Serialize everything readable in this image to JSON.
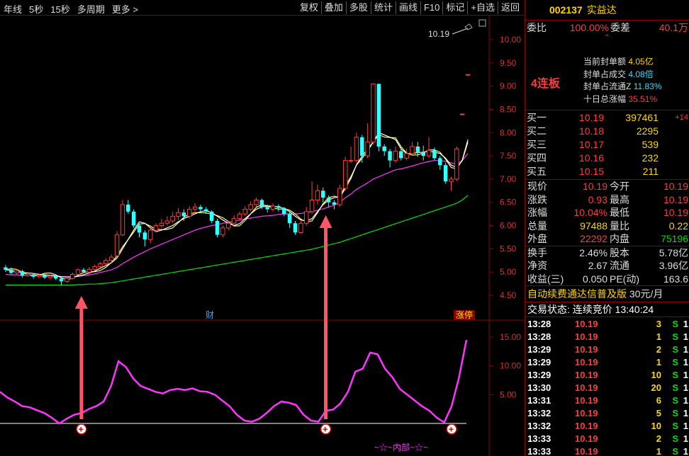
{
  "toolbar": {
    "left": [
      "年线",
      "5秒",
      "15秒",
      "多周期",
      "更多 >"
    ],
    "right": [
      "复权",
      "叠加",
      "多股",
      "统计",
      "画线",
      "F10",
      "标记",
      "+自选",
      "返回"
    ]
  },
  "chart": {
    "price_ticks": [
      "10.00",
      "9.50",
      "9.00",
      "8.50",
      "8.00",
      "7.50",
      "7.00",
      "6.50",
      "6.00",
      "5.50",
      "5.00",
      "4.50"
    ],
    "osc_ticks": [
      "15.00",
      "10.00",
      "5.00"
    ],
    "max_label": "10.19",
    "marker_cai": "财",
    "marker_zhangting": "涨停",
    "bottom_label": "~☆~内部~☆~",
    "colors": {
      "up": "#ff3b3b",
      "down": "#33ffff",
      "ma5": "#ffffff",
      "ma10": "#ffff66",
      "ma20": "#ff33ff",
      "ma60": "#00e000",
      "osc": "#ff33ff",
      "arrow": "#ff5566"
    }
  },
  "stock": {
    "code": "002137",
    "name": "实益达"
  },
  "summary": {
    "weibi_label": "委比",
    "weibi_value": "100.00%",
    "weicha_label": "委差",
    "weicha_value": "40.1万"
  },
  "seal": {
    "tag": "4连板",
    "lines": [
      {
        "label": "当前封单额",
        "value": "4.05亿"
      },
      {
        "label": "封单占成交",
        "value": "4.08倍"
      },
      {
        "label": "封单占流通Z",
        "value": "11.83%"
      },
      {
        "label": "十日总涨幅",
        "value": "35.51%"
      }
    ]
  },
  "bids": [
    {
      "label": "买一",
      "price": "10.19",
      "vol": "397461",
      "chg": "+14"
    },
    {
      "label": "买二",
      "price": "10.18",
      "vol": "2295",
      "chg": ""
    },
    {
      "label": "买三",
      "price": "10.17",
      "vol": "539",
      "chg": ""
    },
    {
      "label": "买四",
      "price": "10.16",
      "vol": "232",
      "chg": ""
    },
    {
      "label": "买五",
      "price": "10.15",
      "vol": "211",
      "chg": ""
    }
  ],
  "quote": [
    {
      "l1": "现价",
      "v1": "10.19",
      "c1": "red",
      "l2": "今开",
      "v2": "10.19",
      "c2": "red"
    },
    {
      "l1": "涨跌",
      "v1": "0.93",
      "c1": "red",
      "l2": "最高",
      "v2": "10.19",
      "c2": "red"
    },
    {
      "l1": "涨幅",
      "v1": "10.04%",
      "c1": "red",
      "l2": "最低",
      "v2": "10.19",
      "c2": "red"
    },
    {
      "l1": "总量",
      "v1": "97488",
      "c1": "ylw",
      "l2": "量比",
      "v2": "0.22",
      "c2": "ylw"
    },
    {
      "l1": "外盘",
      "v1": "22292",
      "c1": "red",
      "l2": "内盘",
      "v2": "75196",
      "c2": "grn"
    }
  ],
  "fin": [
    {
      "l1": "换手",
      "v1": "2.46%",
      "l2": "股本",
      "v2": "5.78亿"
    },
    {
      "l1": "净资",
      "v1": "2.67",
      "l2": "流通",
      "v2": "3.96亿"
    },
    {
      "l1": "收益(三)",
      "v1": "0.050",
      "l2": "PE(动)",
      "v2": "163.6"
    }
  ],
  "ad": {
    "text": "自动续费通达信普及版",
    "price": "30元/月"
  },
  "trade_status": {
    "label": "交易状态:",
    "value": "连续竞价",
    "time": "13:40:24"
  },
  "ticks": [
    {
      "t": "13:28",
      "p": "10.19",
      "v": "3",
      "s": "S",
      "n": "1"
    },
    {
      "t": "13:28",
      "p": "10.19",
      "v": "1",
      "s": "S",
      "n": "1"
    },
    {
      "t": "13:29",
      "p": "10.19",
      "v": "2",
      "s": "S",
      "n": "1"
    },
    {
      "t": "13:29",
      "p": "10.19",
      "v": "1",
      "s": "S",
      "n": "1"
    },
    {
      "t": "13:29",
      "p": "10.19",
      "v": "10",
      "s": "S",
      "n": "1"
    },
    {
      "t": "13:30",
      "p": "10.19",
      "v": "20",
      "s": "S",
      "n": "1"
    },
    {
      "t": "13:31",
      "p": "10.19",
      "v": "6",
      "s": "S",
      "n": "1"
    },
    {
      "t": "13:32",
      "p": "10.19",
      "v": "5",
      "s": "S",
      "n": "1"
    },
    {
      "t": "13:32",
      "p": "10.19",
      "v": "10",
      "s": "S",
      "n": "1"
    },
    {
      "t": "13:33",
      "p": "10.19",
      "v": "2",
      "s": "S",
      "n": "1"
    },
    {
      "t": "13:33",
      "p": "10.19",
      "v": "1",
      "s": "S",
      "n": "1"
    }
  ],
  "chart_data": {
    "type": "candlestick",
    "price_axis": {
      "min": 4.3,
      "max": 10.2
    },
    "candles": [
      [
        5.1,
        5.05,
        5.15,
        5.0
      ],
      [
        5.05,
        4.98,
        5.1,
        4.95
      ],
      [
        4.98,
        5.02,
        5.06,
        4.94
      ],
      [
        5.02,
        4.92,
        5.05,
        4.88
      ],
      [
        4.92,
        4.95,
        5.0,
        4.9
      ],
      [
        4.95,
        4.9,
        4.98,
        4.86
      ],
      [
        4.9,
        4.93,
        4.97,
        4.87
      ],
      [
        4.93,
        4.88,
        4.96,
        4.85
      ],
      [
        4.88,
        4.91,
        4.95,
        4.84
      ],
      [
        4.91,
        4.86,
        4.94,
        4.83
      ],
      [
        4.86,
        4.8,
        4.89,
        4.72
      ],
      [
        4.8,
        4.86,
        4.9,
        4.77
      ],
      [
        4.86,
        4.95,
        4.99,
        4.84
      ],
      [
        4.95,
        5.05,
        5.08,
        4.93
      ],
      [
        5.05,
        5.0,
        5.09,
        4.97
      ],
      [
        5.0,
        5.06,
        5.11,
        4.98
      ],
      [
        5.06,
        5.12,
        5.16,
        5.03
      ],
      [
        5.12,
        5.18,
        5.22,
        5.09
      ],
      [
        5.18,
        5.25,
        5.3,
        5.15
      ],
      [
        5.25,
        5.32,
        5.38,
        5.2
      ],
      [
        5.35,
        5.8,
        5.88,
        5.3
      ],
      [
        5.8,
        6.45,
        6.55,
        5.78
      ],
      [
        6.45,
        6.3,
        6.55,
        6.25
      ],
      [
        6.3,
        6.0,
        6.35,
        5.95
      ],
      [
        6.0,
        5.85,
        6.05,
        5.75
      ],
      [
        5.85,
        5.7,
        5.9,
        5.55
      ],
      [
        5.7,
        5.9,
        5.95,
        5.62
      ],
      [
        5.9,
        6.0,
        6.05,
        5.85
      ],
      [
        6.0,
        6.05,
        6.15,
        5.95
      ],
      [
        6.05,
        6.1,
        6.2,
        6.0
      ],
      [
        6.1,
        6.2,
        6.3,
        6.05
      ],
      [
        6.2,
        6.28,
        6.38,
        6.12
      ],
      [
        6.28,
        6.2,
        6.35,
        6.1
      ],
      [
        6.2,
        6.35,
        6.42,
        6.15
      ],
      [
        6.35,
        6.4,
        6.48,
        6.25
      ],
      [
        6.4,
        6.35,
        6.45,
        6.28
      ],
      [
        6.35,
        6.3,
        6.4,
        6.25
      ],
      [
        6.3,
        6.1,
        6.33,
        6.05
      ],
      [
        6.1,
        5.8,
        6.15,
        5.75
      ],
      [
        5.8,
        5.95,
        6.0,
        5.75
      ],
      [
        5.95,
        6.05,
        6.1,
        5.9
      ],
      [
        6.05,
        6.15,
        6.22,
        6.0
      ],
      [
        6.15,
        6.25,
        6.3,
        6.1
      ],
      [
        6.25,
        6.35,
        6.42,
        6.2
      ],
      [
        6.35,
        6.45,
        6.52,
        6.3
      ],
      [
        6.45,
        6.55,
        6.6,
        6.4
      ],
      [
        6.55,
        6.4,
        6.58,
        6.35
      ],
      [
        6.4,
        6.35,
        6.45,
        6.28
      ],
      [
        6.35,
        6.42,
        6.48,
        6.3
      ],
      [
        6.42,
        6.38,
        6.46,
        6.3
      ],
      [
        6.38,
        6.25,
        6.4,
        6.2
      ],
      [
        6.25,
        6.05,
        6.3,
        5.95
      ],
      [
        6.05,
        5.85,
        6.1,
        5.8
      ],
      [
        5.85,
        6.05,
        6.12,
        5.82
      ],
      [
        6.05,
        6.3,
        6.4,
        6.0
      ],
      [
        6.3,
        6.55,
        6.95,
        6.25
      ],
      [
        6.55,
        6.75,
        6.88,
        6.45
      ],
      [
        6.75,
        6.6,
        6.82,
        6.5
      ],
      [
        6.6,
        6.5,
        6.65,
        6.4
      ],
      [
        6.5,
        6.45,
        6.55,
        6.35
      ],
      [
        6.45,
        6.8,
        6.88,
        6.4
      ],
      [
        6.8,
        7.4,
        7.48,
        6.75
      ],
      [
        7.4,
        7.4,
        7.7,
        7.35
      ],
      [
        7.4,
        7.9,
        8.0,
        7.35
      ],
      [
        7.9,
        7.5,
        7.95,
        7.35
      ],
      [
        7.5,
        7.8,
        8.2,
        7.45
      ],
      [
        7.8,
        9.05,
        9.05,
        7.75
      ],
      [
        9.05,
        7.7,
        9.05,
        7.6
      ],
      [
        7.7,
        7.6,
        7.75,
        7.5
      ],
      [
        7.6,
        7.4,
        7.65,
        7.25
      ],
      [
        7.4,
        7.6,
        7.7,
        7.35
      ],
      [
        7.6,
        7.45,
        7.7,
        7.4
      ],
      [
        7.45,
        7.55,
        7.65,
        7.4
      ],
      [
        7.55,
        7.7,
        7.8,
        7.5
      ],
      [
        7.7,
        7.58,
        7.8,
        7.48
      ],
      [
        7.58,
        7.5,
        7.72,
        7.4
      ],
      [
        7.5,
        7.62,
        7.9,
        7.45
      ],
      [
        7.62,
        7.45,
        7.68,
        7.4
      ],
      [
        7.45,
        7.3,
        7.5,
        7.2
      ],
      [
        7.3,
        6.95,
        7.35,
        6.9
      ],
      [
        6.95,
        7.0,
        7.05,
        6.75
      ],
      [
        7.0,
        7.65,
        7.7,
        6.95
      ],
      [
        8.4,
        8.4,
        8.4,
        8.4
      ],
      [
        9.25,
        9.25,
        9.25,
        9.25
      ]
    ],
    "ma5": [
      5.05,
      5.03,
      5.01,
      4.99,
      4.98,
      4.97,
      4.95,
      4.94,
      4.93,
      4.92,
      4.9,
      4.89,
      4.89,
      4.91,
      4.94,
      4.98,
      5.02,
      5.08,
      5.14,
      5.2,
      5.3,
      5.5,
      5.7,
      5.9,
      6.08,
      6.05,
      5.95,
      5.87,
      5.9,
      5.95,
      6.0,
      6.08,
      6.15,
      6.2,
      6.25,
      6.3,
      6.32,
      6.28,
      6.2,
      6.12,
      6.05,
      6.0,
      6.04,
      6.15,
      6.25,
      6.35,
      6.4,
      6.42,
      6.42,
      6.4,
      6.37,
      6.3,
      6.2,
      6.12,
      6.1,
      6.15,
      6.3,
      6.45,
      6.55,
      6.6,
      6.62,
      6.85,
      7.05,
      7.3,
      7.45,
      7.6,
      7.8,
      8.0,
      7.95,
      7.9,
      7.85,
      7.65,
      7.55,
      7.55,
      7.57,
      7.58,
      7.6,
      7.58,
      7.55,
      7.45,
      7.3,
      7.25,
      7.4,
      7.8
    ],
    "ma20": [
      4.95,
      4.94,
      4.94,
      4.93,
      4.93,
      4.92,
      4.92,
      4.91,
      4.91,
      4.91,
      4.9,
      4.9,
      4.9,
      4.91,
      4.92,
      4.94,
      4.96,
      4.99,
      5.02,
      5.05,
      5.1,
      5.18,
      5.25,
      5.32,
      5.38,
      5.44,
      5.5,
      5.55,
      5.6,
      5.65,
      5.7,
      5.75,
      5.8,
      5.85,
      5.9,
      5.94,
      5.97,
      6.0,
      6.02,
      6.05,
      6.07,
      6.09,
      6.12,
      6.14,
      6.16,
      6.18,
      6.2,
      6.21,
      6.22,
      6.24,
      6.25,
      6.25,
      6.25,
      6.26,
      6.28,
      6.3,
      6.33,
      6.36,
      6.4,
      6.44,
      6.5,
      6.6,
      6.68,
      6.78,
      6.85,
      6.92,
      7.0,
      7.05,
      7.1,
      7.15,
      7.2,
      7.22,
      7.25,
      7.28,
      7.32,
      7.35,
      7.38,
      7.4,
      7.4,
      7.38,
      7.35,
      7.32,
      7.4,
      7.55
    ],
    "ma60": [
      4.72,
      4.72,
      4.72,
      4.72,
      4.72,
      4.72,
      4.72,
      4.72,
      4.72,
      4.72,
      4.72,
      4.72,
      4.72,
      4.73,
      4.73,
      4.74,
      4.74,
      4.75,
      4.76,
      4.77,
      4.79,
      4.81,
      4.83,
      4.85,
      4.87,
      4.89,
      4.91,
      4.93,
      4.95,
      4.97,
      4.99,
      5.01,
      5.03,
      5.05,
      5.07,
      5.09,
      5.11,
      5.13,
      5.15,
      5.17,
      5.19,
      5.21,
      5.23,
      5.25,
      5.27,
      5.29,
      5.31,
      5.33,
      5.35,
      5.37,
      5.39,
      5.41,
      5.43,
      5.45,
      5.47,
      5.49,
      5.52,
      5.55,
      5.58,
      5.61,
      5.64,
      5.68,
      5.72,
      5.76,
      5.8,
      5.84,
      5.88,
      5.92,
      5.96,
      6.0,
      6.04,
      6.08,
      6.12,
      6.16,
      6.2,
      6.24,
      6.28,
      6.32,
      6.36,
      6.4,
      6.44,
      6.48,
      6.55,
      6.65
    ],
    "osc_axis": {
      "min": -1.5,
      "max": 17
    },
    "osc": [
      5.5,
      4.5,
      3.8,
      3.0,
      2.8,
      2.3,
      1.8,
      1.0,
      0.0,
      0.8,
      1.5,
      1.8,
      2.5,
      3.0,
      3.8,
      6.5,
      10.8,
      9.8,
      7.8,
      6.5,
      6.0,
      5.5,
      5.2,
      5.8,
      6.0,
      5.8,
      6.1,
      5.6,
      5.5,
      5.0,
      4.0,
      3.0,
      1.5,
      0.5,
      0.3,
      0.8,
      1.8,
      3.0,
      3.8,
      3.6,
      3.2,
      1.5,
      0.5,
      0.3,
      2.2,
      2.4,
      3.5,
      5.5,
      9.0,
      9.5,
      12.3,
      12.0,
      9.5,
      8.0,
      6.0,
      5.0,
      4.0,
      3.0,
      2.2,
      1.0,
      0.2,
      3.0,
      8.0,
      14.5
    ],
    "buy_markers_osc_index": [
      11,
      44,
      61
    ]
  }
}
